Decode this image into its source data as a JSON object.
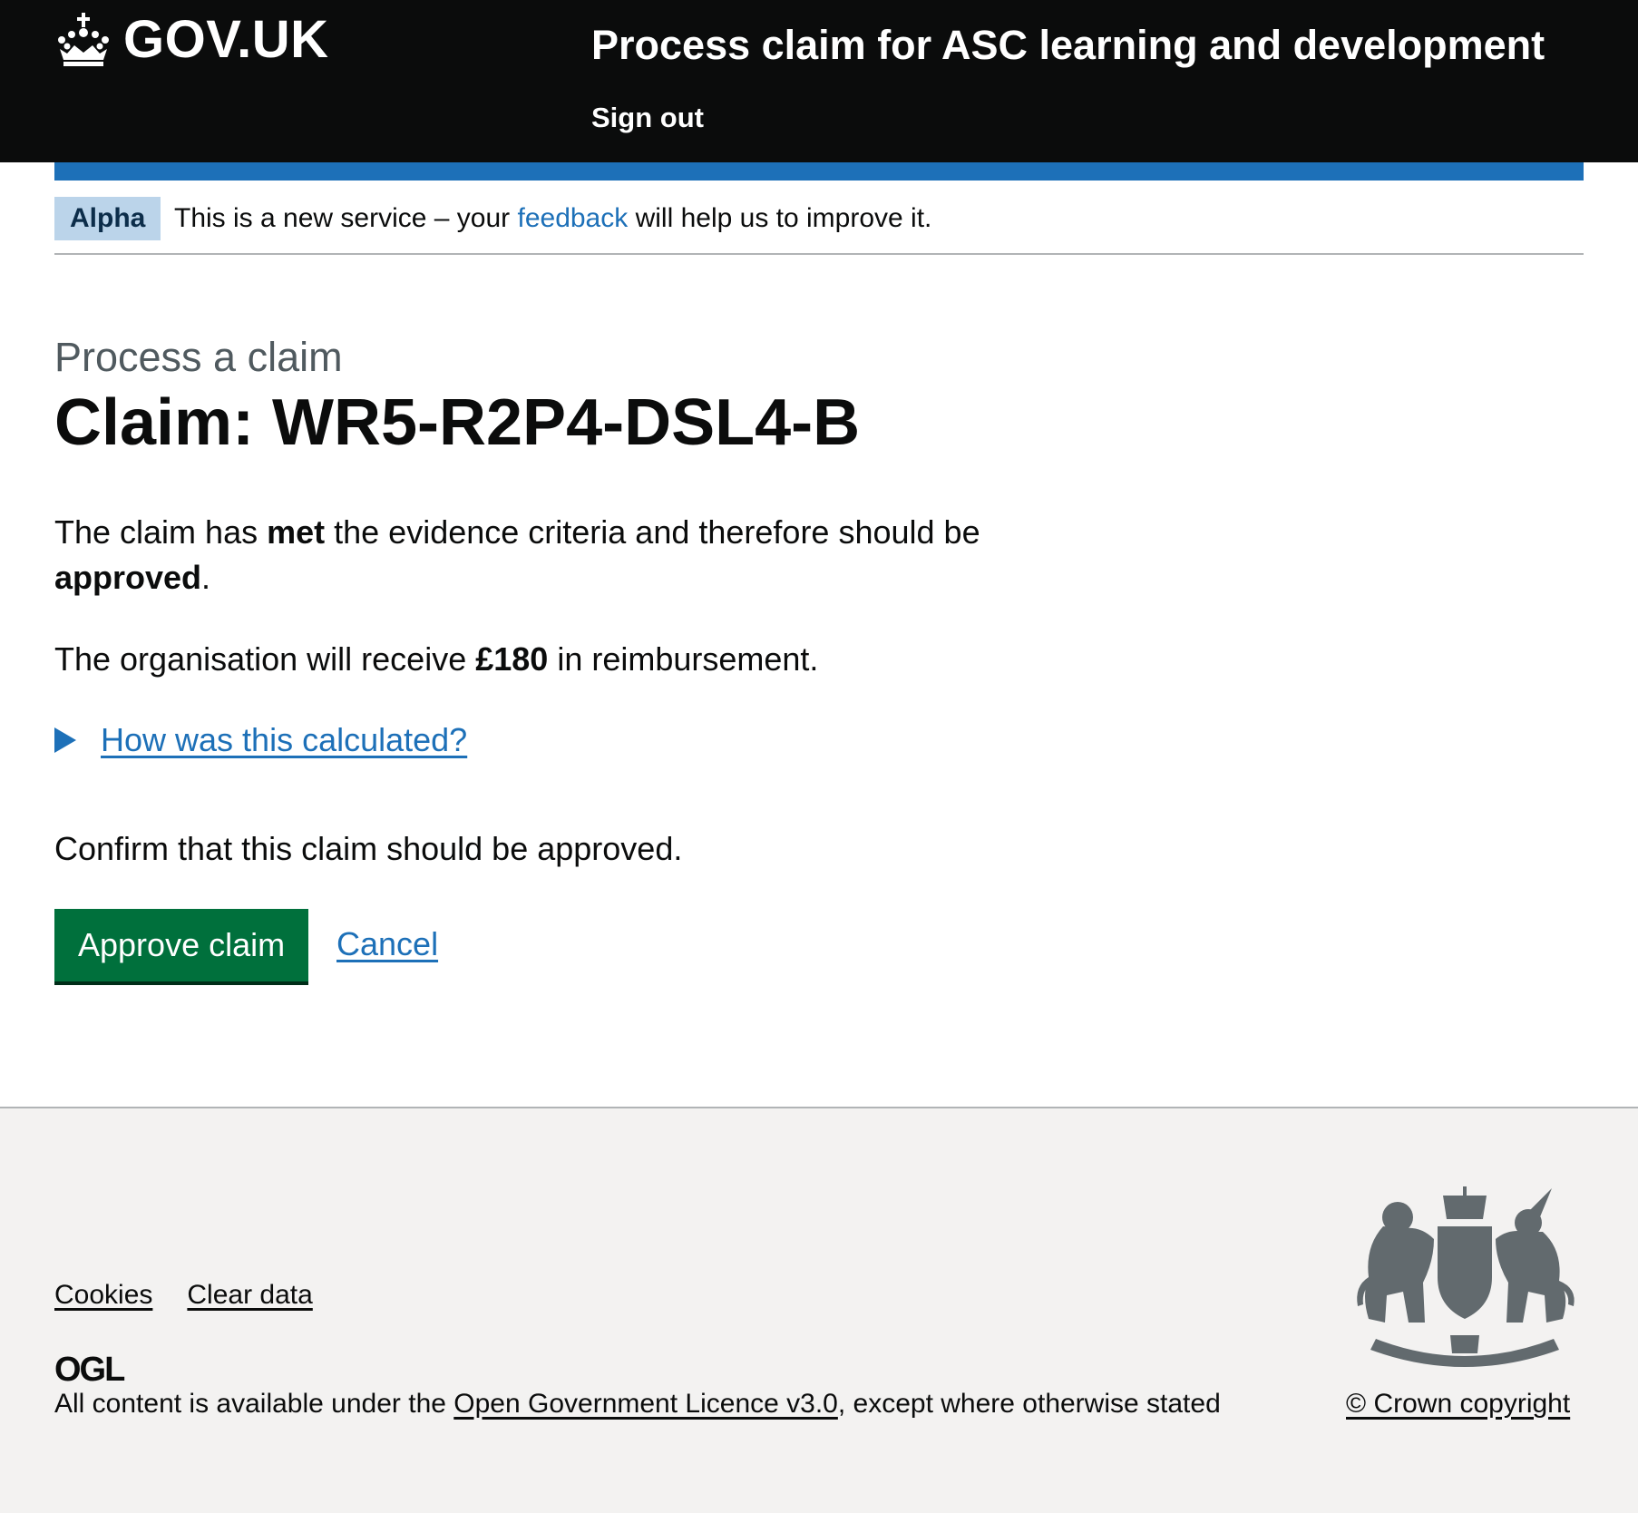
{
  "header": {
    "logo_text": "GOV.UK",
    "service_name": "Process claim for ASC learning and development",
    "sign_out": "Sign out"
  },
  "phase_banner": {
    "tag": "Alpha",
    "text_before": "This is a new service – your ",
    "link": "feedback",
    "text_after": " will help us to improve it."
  },
  "main": {
    "caption": "Process a claim",
    "heading": "Claim: WR5-R2P4-DSL4-B",
    "outcome": {
      "before": "The claim has ",
      "met": "met",
      "middle": " the evidence criteria and therefore should be ",
      "approved": "approved",
      "after": "."
    },
    "reimbursement": {
      "before": "The organisation will receive ",
      "amount": "£180",
      "after": " in reimbursement."
    },
    "details_summary": "How was this calculated?",
    "confirm_text": "Confirm that this claim should be approved.",
    "approve_button": "Approve claim",
    "cancel_link": "Cancel"
  },
  "footer": {
    "links": [
      "Cookies",
      "Clear data"
    ],
    "ogl_logo": "OGL",
    "licence_before": "All content is available under the ",
    "licence_link": "Open Government Licence v3.0",
    "licence_after": ", except where otherwise stated",
    "copyright": "© Crown copyright"
  },
  "colors": {
    "header_bg": "#0b0c0c",
    "accent_blue": "#1d70b8",
    "button_green": "#00703c",
    "phase_tag_bg": "#bbd4ea",
    "footer_bg": "#f3f2f1"
  },
  "icons": {
    "logo": "crown-icon",
    "details": "triangle-right-icon",
    "crest": "royal-coat-of-arms-icon"
  }
}
